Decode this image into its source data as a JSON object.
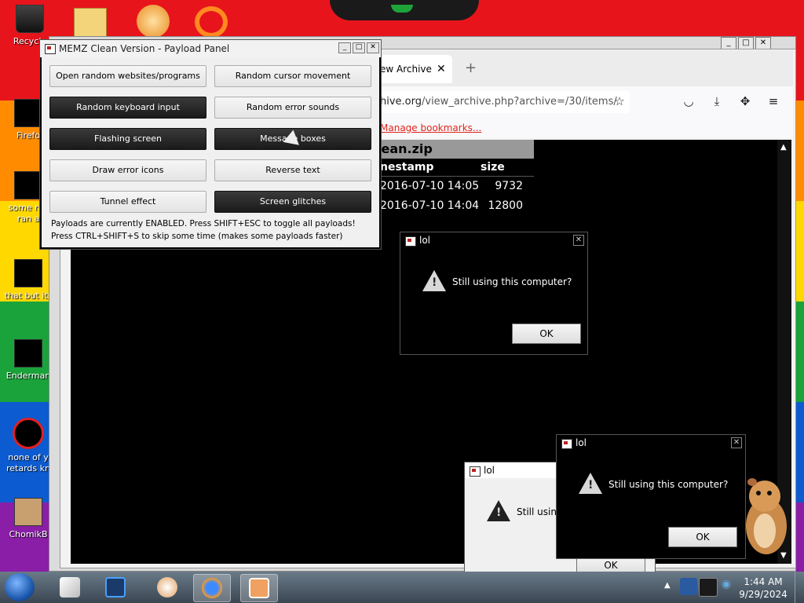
{
  "desktop": {
    "icons": [
      {
        "label": "Recycle"
      },
      {
        "label": "Firefo"
      },
      {
        "label": "some rus ran a"
      },
      {
        "label": "that but its"
      },
      {
        "label": "Enderman"
      },
      {
        "label": "none of y retards kn"
      },
      {
        "label": "ChomikB"
      }
    ]
  },
  "browser": {
    "tab_label": "ew Archive",
    "tab_close": "✕",
    "new_tab": "+",
    "url_host": "hive.org",
    "url_path": "/view_archive.php?archive=/30/items/",
    "bookmark": "Manage bookmarks...",
    "archive": {
      "title": "lean.zip",
      "headers": [
        "nestamp",
        "size"
      ],
      "rows": [
        {
          "timestamp": "2016-07-10 14:05",
          "size": "9732"
        },
        {
          "timestamp": "2016-07-10 14:04",
          "size": "12800"
        }
      ]
    }
  },
  "memz": {
    "title": "MEMZ Clean Version - Payload Panel",
    "buttons": [
      {
        "label": "Open random websites/programs",
        "enabled": false
      },
      {
        "label": "Random cursor movement",
        "enabled": false
      },
      {
        "label": "Random keyboard input",
        "enabled": true
      },
      {
        "label": "Random error sounds",
        "enabled": false
      },
      {
        "label": "Flashing screen",
        "enabled": true
      },
      {
        "label": "Message boxes",
        "enabled": true
      },
      {
        "label": "Draw error icons",
        "enabled": false
      },
      {
        "label": "Reverse text",
        "enabled": false
      },
      {
        "label": "Tunnel effect",
        "enabled": false
      },
      {
        "label": "Screen glitches",
        "enabled": true
      }
    ],
    "note1": "Payloads are currently ENABLED. Press SHIFT+ESC to toggle all payloads!",
    "note2": "Press CTRL+SHIFT+S to skip some time (makes some payloads faster)"
  },
  "dialogs": [
    {
      "title": "lol",
      "message": "Still using this computer?",
      "ok": "OK"
    },
    {
      "title": "lol",
      "message": "Still using",
      "ok": "OK"
    },
    {
      "title": "lol",
      "message": "Still using this computer?",
      "ok": "OK"
    }
  ],
  "taskbar": {
    "time": "1:44 AM",
    "date": "9/29/2024"
  },
  "colors": {
    "rainbow": [
      "#e8141c",
      "#ff8c00",
      "#ffd800",
      "#1aa33a",
      "#0d5bd1",
      "#8a1ea6"
    ]
  }
}
